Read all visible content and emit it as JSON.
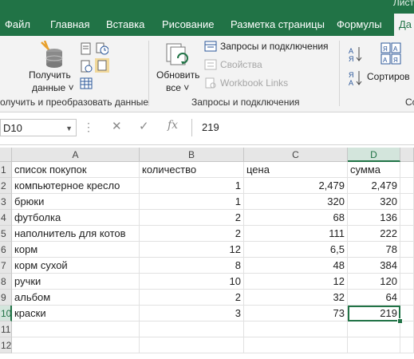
{
  "window": {
    "title_fragment": "Лист"
  },
  "ribbon_tabs": [
    {
      "label": "Файл"
    },
    {
      "label": "Главная"
    },
    {
      "label": "Вставка"
    },
    {
      "label": "Рисование"
    },
    {
      "label": "Разметка страницы"
    },
    {
      "label": "Формулы"
    },
    {
      "label": "Да"
    }
  ],
  "ribbon": {
    "get_data": {
      "line1": "Получить",
      "line2": "данные ˅"
    },
    "refresh_all": {
      "line1": "Обновить",
      "line2": "все ˅"
    },
    "queries_connections": "Запросы и подключения",
    "properties": "Свойства",
    "workbook_links": "Workbook Links",
    "sort": "Сортиров",
    "group_get_transform": "олучить и преобразовать данные",
    "group_queries": "Запросы и подключения",
    "group_partial": "Со"
  },
  "formula_bar": {
    "name_box": "D10",
    "fx": "fx",
    "value": "219"
  },
  "sheet": {
    "columns": [
      "A",
      "B",
      "C",
      "D"
    ],
    "selected_column": "D",
    "selected_row": "10",
    "rows": [
      {
        "n": "1",
        "a": "список покупок",
        "b": "количество",
        "c": "цена",
        "d": "сумма"
      },
      {
        "n": "2",
        "a": "компьютерное кресло",
        "b": "1",
        "c": "2,479",
        "d": "2,479"
      },
      {
        "n": "3",
        "a": "брюки",
        "b": "1",
        "c": "320",
        "d": "320"
      },
      {
        "n": "4",
        "a": "футболка",
        "b": "2",
        "c": "68",
        "d": "136"
      },
      {
        "n": "5",
        "a": "наполнитель для котов",
        "b": "2",
        "c": "111",
        "d": "222"
      },
      {
        "n": "6",
        "a": "корм",
        "b": "12",
        "c": "6,5",
        "d": "78"
      },
      {
        "n": "7",
        "a": "корм сухой",
        "b": "8",
        "c": "48",
        "d": "384"
      },
      {
        "n": "8",
        "a": "ручки",
        "b": "10",
        "c": "12",
        "d": "120"
      },
      {
        "n": "9",
        "a": "альбом",
        "b": "2",
        "c": "32",
        "d": "64"
      },
      {
        "n": "10",
        "a": "краски",
        "b": "3",
        "c": "73",
        "d": "219"
      },
      {
        "n": "11",
        "a": "",
        "b": "",
        "c": "",
        "d": ""
      },
      {
        "n": "12",
        "a": "",
        "b": "",
        "c": "",
        "d": ""
      }
    ]
  },
  "colors": {
    "accent": "#217346",
    "ribbon_bg": "#f3f3f3",
    "header_bg": "#e6e6e6"
  }
}
